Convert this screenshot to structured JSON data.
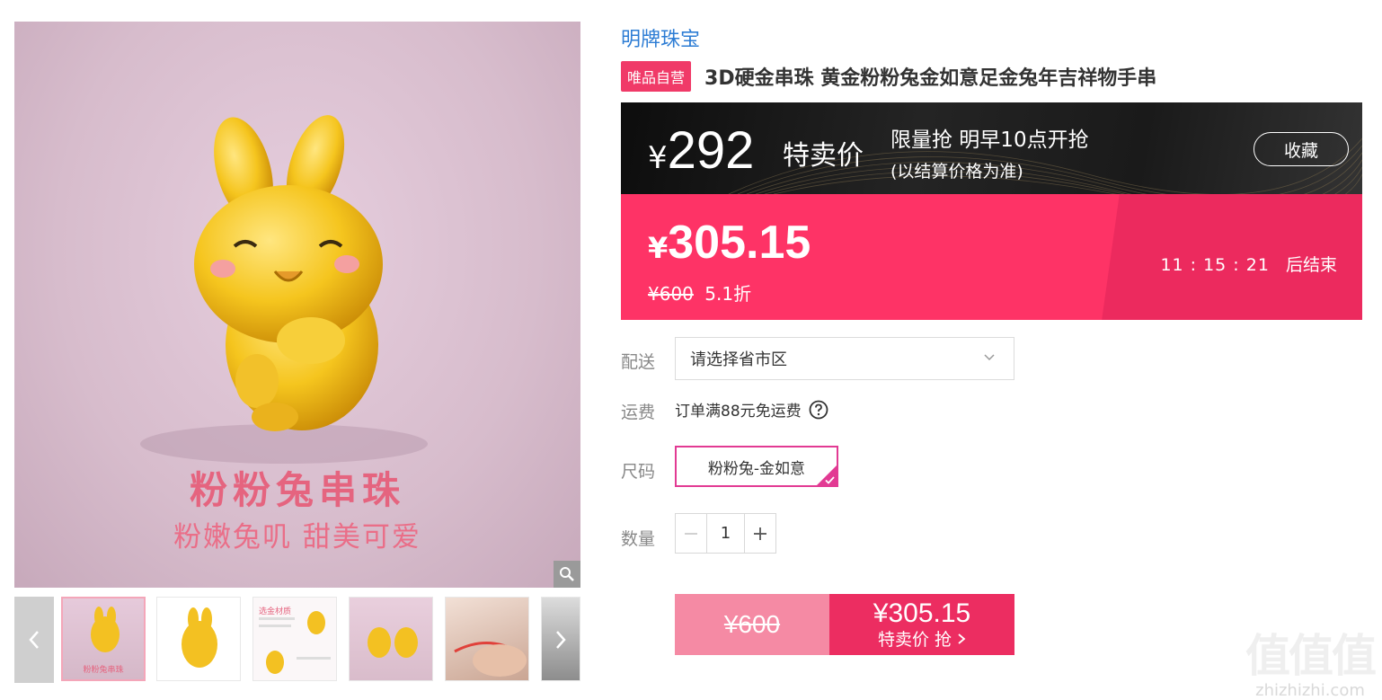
{
  "gallery": {
    "caption_title": "粉粉兔串珠",
    "caption_sub": "粉嫩兔叽  甜美可爱",
    "thumb_caption_1": "粉粉兔串珠",
    "thumb_text_3": "选金材质"
  },
  "product": {
    "brand": "明牌珠宝",
    "badge": "唯品自营",
    "title": "3D硬金串珠 黄金粉粉兔金如意足金兔年吉祥物手串"
  },
  "promo": {
    "yen": "¥",
    "price": "292",
    "label": "特卖价",
    "info_line1": "限量抢 明早10点开抢",
    "info_line2": "(以结算价格为准)",
    "favorite_label": "收藏"
  },
  "sale": {
    "yen": "¥",
    "price": "305.15",
    "original_price": "¥600",
    "discount": "5.1折",
    "countdown": "11 : 15 : 21",
    "countdown_suffix": "后结束"
  },
  "options": {
    "delivery_label": "配送",
    "region_placeholder": "请选择省市区",
    "shipping_label": "运费",
    "shipping_text": "订单满88元免运费",
    "size_label": "尺码",
    "size_selected": "粉粉兔-金如意",
    "quantity_label": "数量",
    "quantity_value": "1"
  },
  "buy": {
    "original_price": "¥600",
    "price": "¥305.15",
    "action_label": "特卖价 抢"
  },
  "watermark": {
    "big": "值值值",
    "small": "zhizhizhi.com"
  },
  "colors": {
    "accent_pink": "#fe3366",
    "buy_pink": "#ec2d61",
    "link_blue": "#2c7cd4",
    "size_border": "#e23a93"
  }
}
